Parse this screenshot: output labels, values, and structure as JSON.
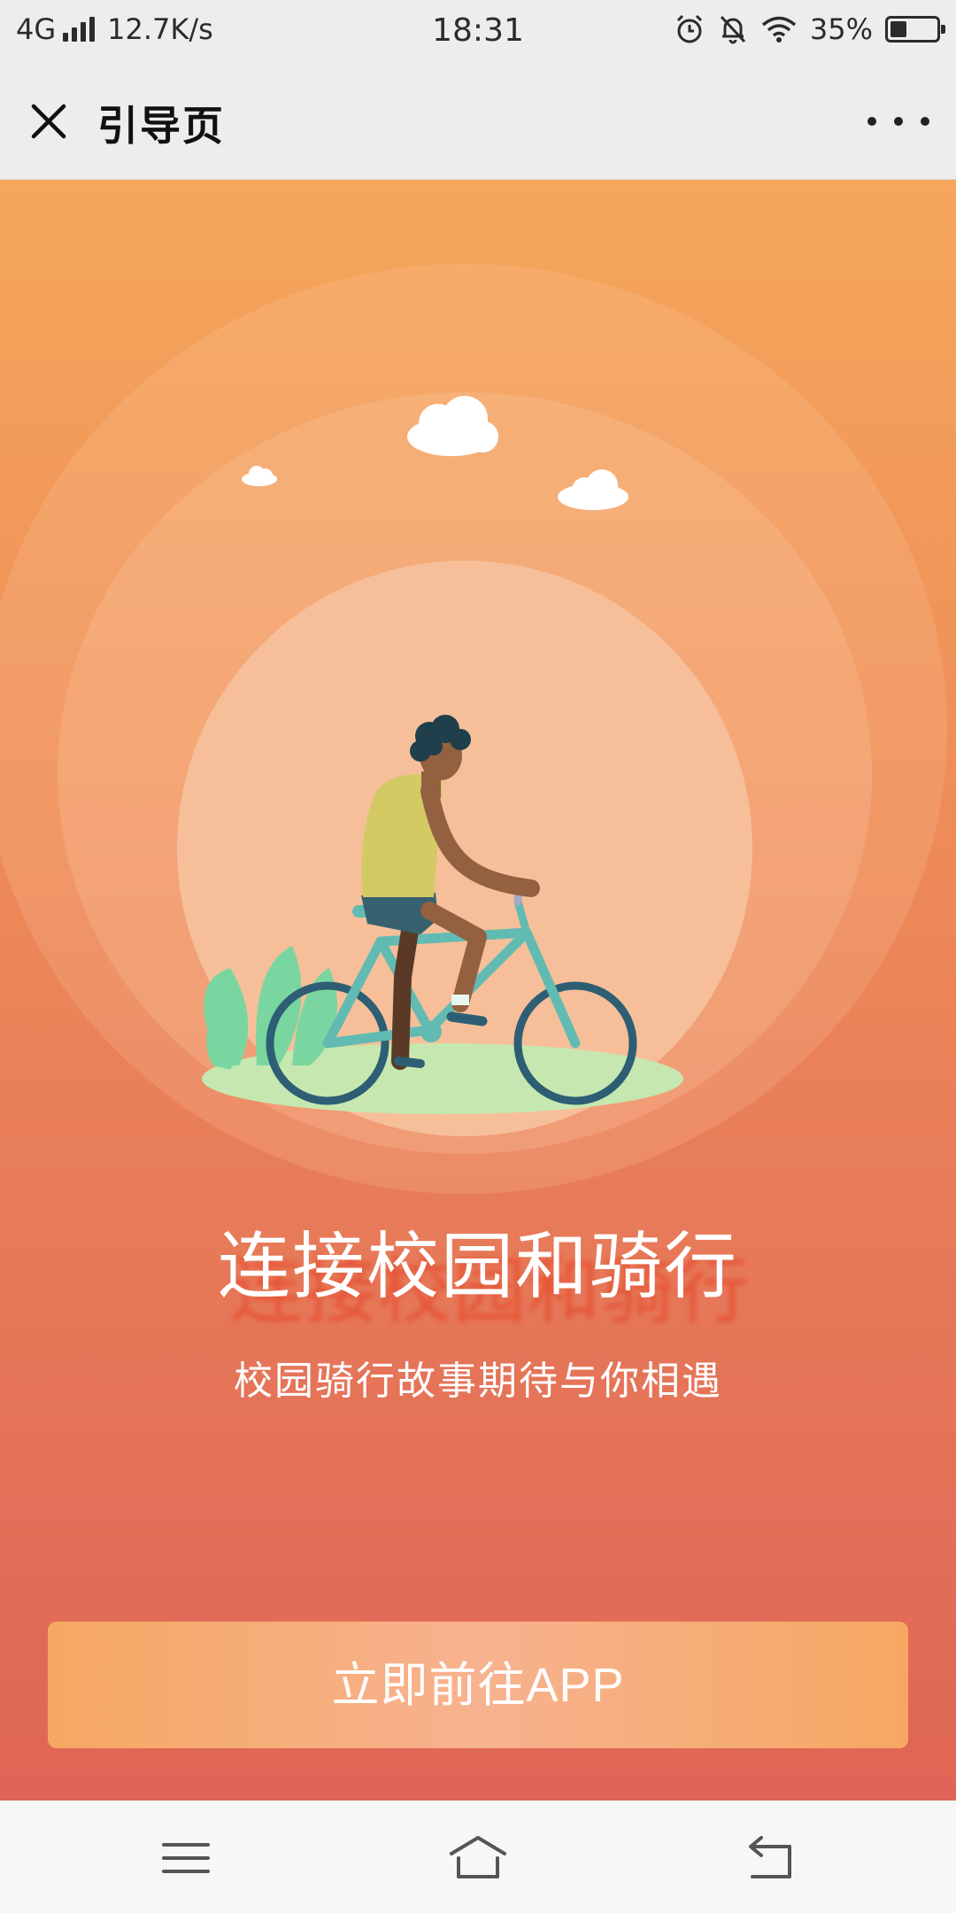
{
  "status_bar": {
    "network": "4G",
    "speed": "12.7K/s",
    "time": "18:31",
    "battery": "35%",
    "battery_level": 0.35,
    "icons": [
      "alarm-icon",
      "mute-bell-icon",
      "wifi-icon",
      "battery-icon"
    ]
  },
  "nav": {
    "title": "引导页",
    "close_icon": "close-icon",
    "more_icon": "more-dots-icon"
  },
  "hero": {
    "headline": "连接校园和骑行",
    "subhead": "校园骑行故事期待与你相遇",
    "illustration": "cyclist-illustration"
  },
  "cta": {
    "label": "立即前往APP"
  },
  "system_nav": {
    "icons": [
      "menu-icon",
      "home-icon",
      "back-icon"
    ]
  },
  "colors": {
    "gradient_top": "#f5a75c",
    "gradient_bottom": "#df6556",
    "button": "#f6a862",
    "bike": "#5ec2b6"
  }
}
